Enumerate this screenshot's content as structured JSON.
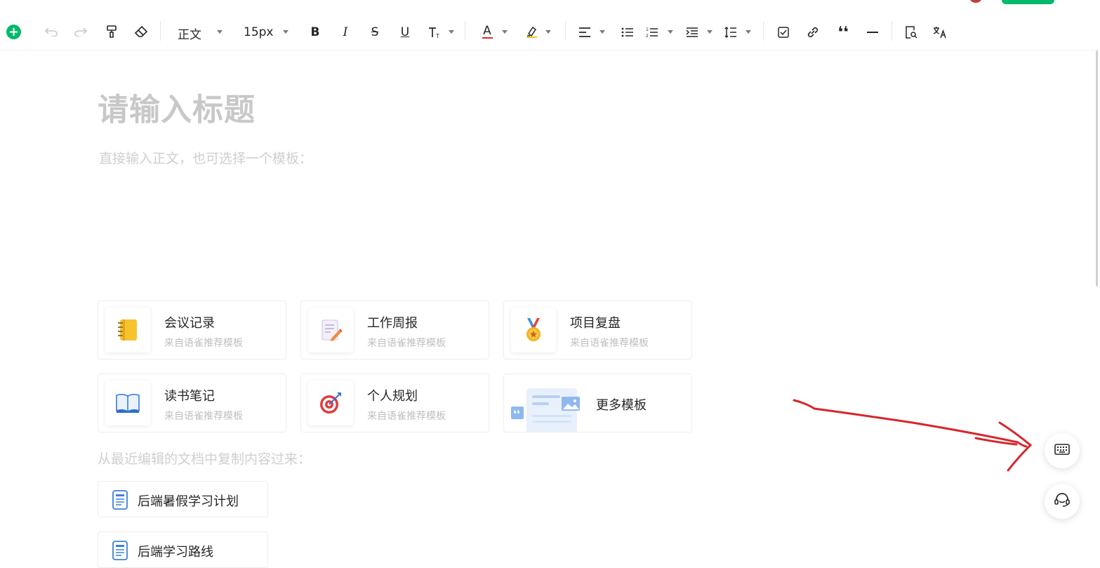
{
  "toolbar": {
    "paragraph_style": "正文",
    "font_size": "15px"
  },
  "editor": {
    "title_placeholder": "请输入标题",
    "body_hint": "直接输入正文，也可选择一个模板："
  },
  "templates": [
    {
      "name": "会议记录",
      "source": "来自语雀推荐模板",
      "icon": "notebook-icon"
    },
    {
      "name": "工作周报",
      "source": "来自语雀推荐模板",
      "icon": "report-pencil-icon"
    },
    {
      "name": "项目复盘",
      "source": "来自语雀推荐模板",
      "icon": "medal-icon"
    },
    {
      "name": "读书笔记",
      "source": "来自语雀推荐模板",
      "icon": "open-book-icon"
    },
    {
      "name": "个人规划",
      "source": "来自语雀推荐模板",
      "icon": "target-icon"
    },
    {
      "name": "更多模板",
      "icon": "template-gallery-icon"
    }
  ],
  "recent": {
    "hint": "从最近编辑的文档中复制内容过来：",
    "docs": [
      {
        "name": "后端暑假学习计划",
        "icon": "document-icon"
      },
      {
        "name": "后端学习路线",
        "icon": "document-icon"
      }
    ]
  },
  "colors": {
    "brand_green": "#00b96b",
    "annotation_red": "#d7262b",
    "text_color_underline": "#e0282e",
    "highlight_underline": "#f5c518"
  }
}
